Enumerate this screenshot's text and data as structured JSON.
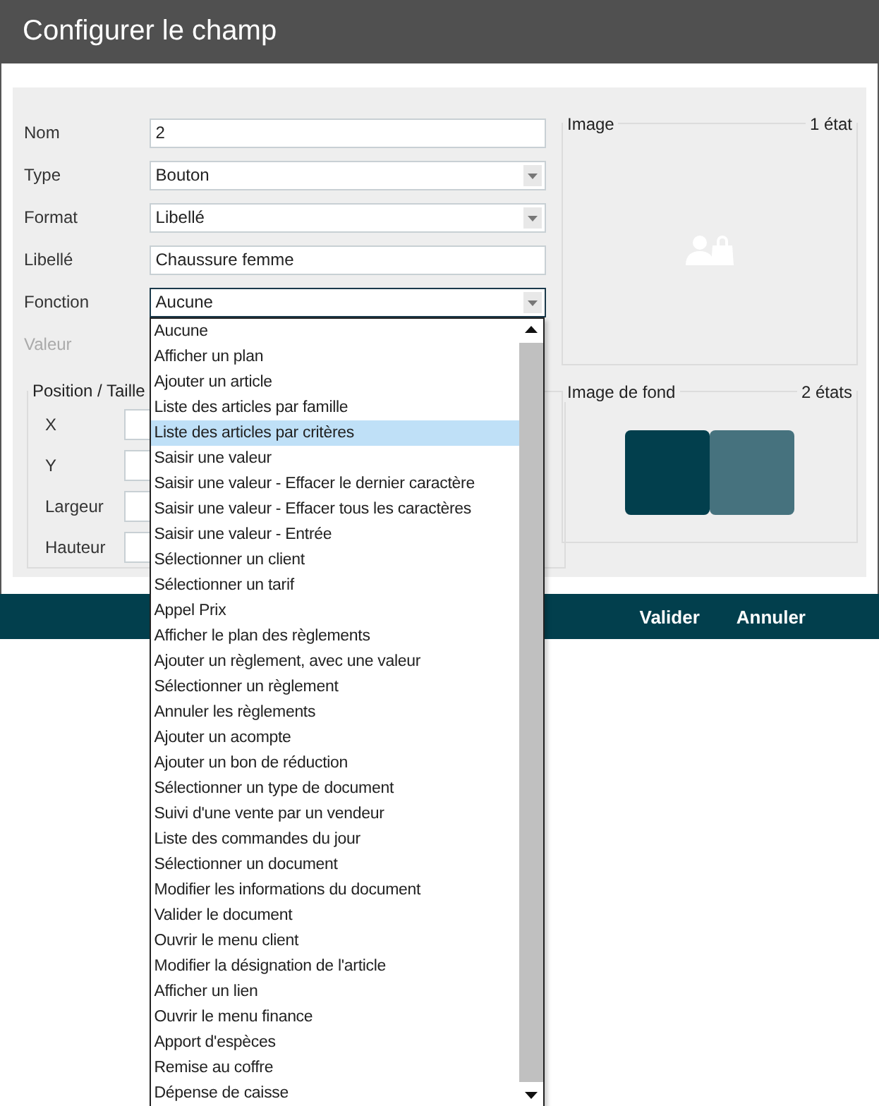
{
  "window": {
    "title": "Configurer le champ"
  },
  "fields": [
    {
      "label": "Nom",
      "kind": "text",
      "value": "2"
    },
    {
      "label": "Type",
      "kind": "select",
      "value": "Bouton"
    },
    {
      "label": "Format",
      "kind": "select",
      "value": "Libellé"
    },
    {
      "label": "Libellé",
      "kind": "text",
      "value": "Chaussure femme"
    },
    {
      "label": "Fonction",
      "kind": "select",
      "value": "Aucune",
      "expanded": true
    },
    {
      "label": "Valeur",
      "disabled": true
    }
  ],
  "function_options": [
    {
      "label": "Aucune",
      "selected": false
    },
    {
      "label": "Afficher un plan",
      "selected": false
    },
    {
      "label": "Ajouter un article",
      "selected": false
    },
    {
      "label": "Liste des articles par famille",
      "selected": false
    },
    {
      "label": "Liste des articles par critères",
      "selected": true
    },
    {
      "label": "Saisir une valeur",
      "selected": false
    },
    {
      "label": "Saisir une valeur - Effacer le dernier caractère",
      "selected": false
    },
    {
      "label": "Saisir une valeur - Effacer tous les caractères",
      "selected": false
    },
    {
      "label": "Saisir une valeur - Entrée",
      "selected": false
    },
    {
      "label": "Sélectionner un client",
      "selected": false
    },
    {
      "label": "Sélectionner un tarif",
      "selected": false
    },
    {
      "label": "Appel Prix",
      "selected": false
    },
    {
      "label": "Afficher le plan des règlements",
      "selected": false
    },
    {
      "label": "Ajouter un règlement, avec une valeur",
      "selected": false
    },
    {
      "label": "Sélectionner un règlement",
      "selected": false
    },
    {
      "label": "Annuler les règlements",
      "selected": false
    },
    {
      "label": "Ajouter un acompte",
      "selected": false
    },
    {
      "label": "Ajouter un bon de réduction",
      "selected": false
    },
    {
      "label": "Sélectionner un type de document",
      "selected": false
    },
    {
      "label": "Suivi d'une vente par un vendeur",
      "selected": false
    },
    {
      "label": "Liste des commandes du jour",
      "selected": false
    },
    {
      "label": "Sélectionner un document",
      "selected": false
    },
    {
      "label": "Modifier les informations du document",
      "selected": false
    },
    {
      "label": "Valider le document",
      "selected": false
    },
    {
      "label": "Ouvrir le menu client",
      "selected": false
    },
    {
      "label": "Modifier la désignation de l'article",
      "selected": false
    },
    {
      "label": "Afficher un lien",
      "selected": false
    },
    {
      "label": "Ouvrir le menu finance",
      "selected": false
    },
    {
      "label": "Apport d'espèces",
      "selected": false
    },
    {
      "label": "Remise au coffre",
      "selected": false
    },
    {
      "label": "Dépense de caisse",
      "selected": false
    }
  ],
  "position": {
    "title": "Position / Taille",
    "fields": [
      {
        "label": "X"
      },
      {
        "label": "Y"
      },
      {
        "label": "Largeur"
      },
      {
        "label": "Hauteur"
      }
    ]
  },
  "image": {
    "title": "Image",
    "count": "1 état"
  },
  "background_image": {
    "title": "Image de fond",
    "count": "2 états",
    "swatches": [
      {
        "color": "#023f4d"
      },
      {
        "color": "#46727e"
      }
    ]
  },
  "buttons": [
    "Valider",
    "Annuler"
  ]
}
